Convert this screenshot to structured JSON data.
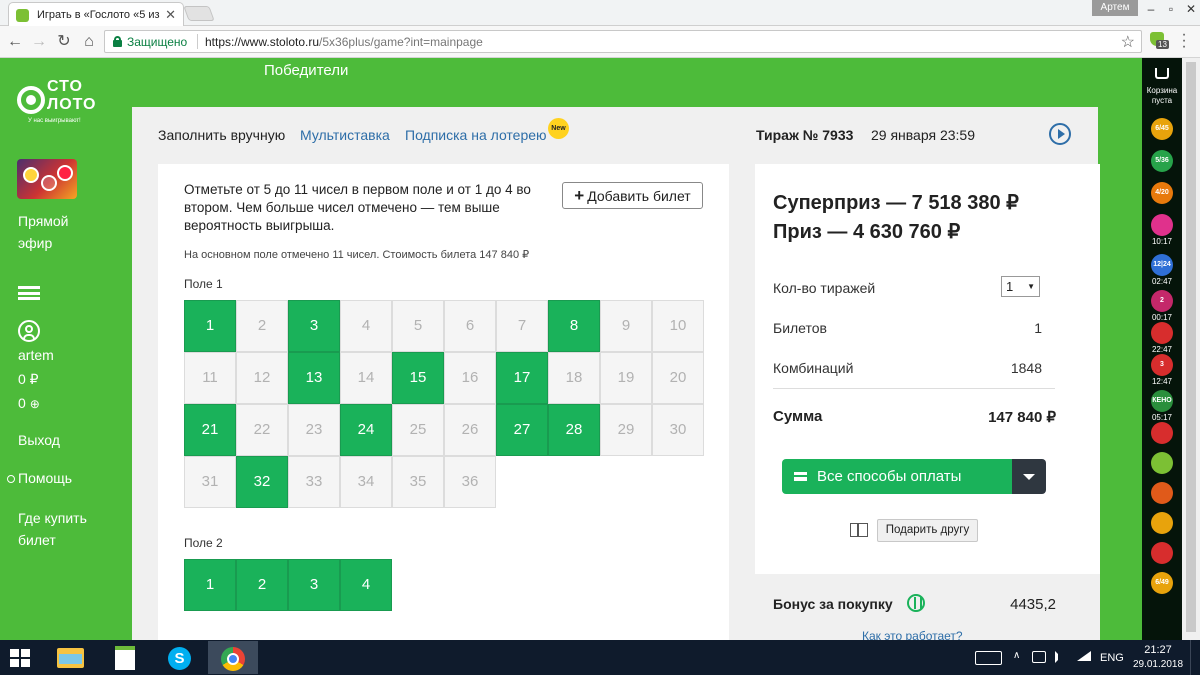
{
  "browser": {
    "tab_title": "Играть в «Гослото «5 из",
    "user": "Артем",
    "secure_label": "Защищено",
    "url_host": "https://www.stoloto.ru",
    "url_path": "/5x36plus/game?int=mainpage",
    "extension_count": "13"
  },
  "site": {
    "logo_line1": "СТО",
    "logo_line2": "ЛОТО",
    "logo_tagline": "У нас выигрывают!",
    "winners_link": "Победители"
  },
  "sidebar": {
    "live_line1": "Прямой",
    "live_line2": "эфир",
    "username": "artem",
    "balance": "0 ₽",
    "bonus": "0",
    "logout": "Выход",
    "help": "Помощь",
    "where_buy_line1": "Где купить",
    "where_buy_line2": "билет"
  },
  "game": {
    "tabs": {
      "manual": "Заполнить вручную",
      "multi": "Мультиставка",
      "subscription": "Подписка на лотерею",
      "new_badge": "New"
    },
    "draw_number": "Тираж № 7933",
    "draw_date": "29 января 23:59",
    "instructions": "Отметьте от 5 до 11 чисел в первом поле и от 1 до 4 во втором. Чем больше чисел отмечено — тем выше вероятность выигрыша.",
    "add_ticket": "Добавить билет",
    "note": "На основном поле отмечено 11 чисел. Стоимость билета 147 840 ₽",
    "field1_label": "Поле 1",
    "field2_label": "Поле 2",
    "field1_numbers": [
      "1",
      "2",
      "3",
      "4",
      "5",
      "6",
      "7",
      "8",
      "9",
      "10",
      "11",
      "12",
      "13",
      "14",
      "15",
      "16",
      "17",
      "18",
      "19",
      "20",
      "21",
      "22",
      "23",
      "24",
      "25",
      "26",
      "27",
      "28",
      "29",
      "30",
      "31",
      "32",
      "33",
      "34",
      "35",
      "36"
    ],
    "field1_selected": [
      1,
      3,
      8,
      13,
      15,
      17,
      21,
      24,
      27,
      28,
      32
    ],
    "field2_numbers": [
      "1",
      "2",
      "3",
      "4"
    ],
    "field2_selected": [
      1,
      2,
      3,
      4
    ]
  },
  "summary": {
    "superprize": "Суперприз — 7 518 380 ₽",
    "prize": "Приз — 4 630 760 ₽",
    "draws_label": "Кол-во тиражей",
    "draws_value": "1",
    "tickets_label": "Билетов",
    "tickets_value": "1",
    "combinations_label": "Комбинаций",
    "combinations_value": "1848",
    "total_label": "Сумма",
    "total_value": "147 840 ₽",
    "pay_button": "Все способы оплаты",
    "gift_button": "Подарить другу",
    "bonus_label": "Бонус за покупку",
    "bonus_value": "4435,2",
    "bonus_how": "Как это работает?"
  },
  "rail": {
    "cart_line1": "Корзина",
    "cart_line2": "пуста",
    "items": [
      {
        "icon": "6-45-icon",
        "label": "6/45",
        "time": "",
        "color": "#e8a30c"
      },
      {
        "icon": "5-36-icon",
        "label": "5/36",
        "time": "",
        "color": "#27a34a"
      },
      {
        "icon": "4-20-icon",
        "label": "4/20",
        "time": "",
        "color": "#e87a0c"
      },
      {
        "icon": "rapido-icon",
        "label": "",
        "time": "10:17",
        "color": "#e0318c"
      },
      {
        "icon": "12-24-icon",
        "label": "12|24",
        "time": "02:47",
        "color": "#2f6fd6"
      },
      {
        "icon": "duel-icon",
        "label": "2",
        "time": "00:17",
        "color": "#c4286a"
      },
      {
        "icon": "top3-icon",
        "label": "",
        "time": "22:47",
        "color": "#d72d2d"
      },
      {
        "icon": "3-icon",
        "label": "3",
        "time": "12:47",
        "color": "#d72d2d"
      },
      {
        "icon": "keno-icon",
        "label": "КЕНО",
        "time": "05:17",
        "color": "#2a8f3c"
      },
      {
        "icon": "bingo-icon",
        "label": "",
        "time": "",
        "color": "#d72d2d"
      },
      {
        "icon": "zhilishnaya-icon",
        "label": "",
        "time": "",
        "color": "#7cc034"
      },
      {
        "icon": "rusloto-icon",
        "label": "",
        "time": "",
        "color": "#e05a1a"
      },
      {
        "icon": "horseshoe-icon",
        "label": "",
        "time": "",
        "color": "#e8a30c"
      },
      {
        "icon": "7-49-icon",
        "label": "",
        "time": "",
        "color": "#d72d2d"
      },
      {
        "icon": "sportloto-icon",
        "label": "6/49",
        "time": "",
        "color": "#e8a30c"
      }
    ]
  },
  "taskbar": {
    "lang": "ENG",
    "time": "21:27",
    "date": "29.01.2018"
  }
}
